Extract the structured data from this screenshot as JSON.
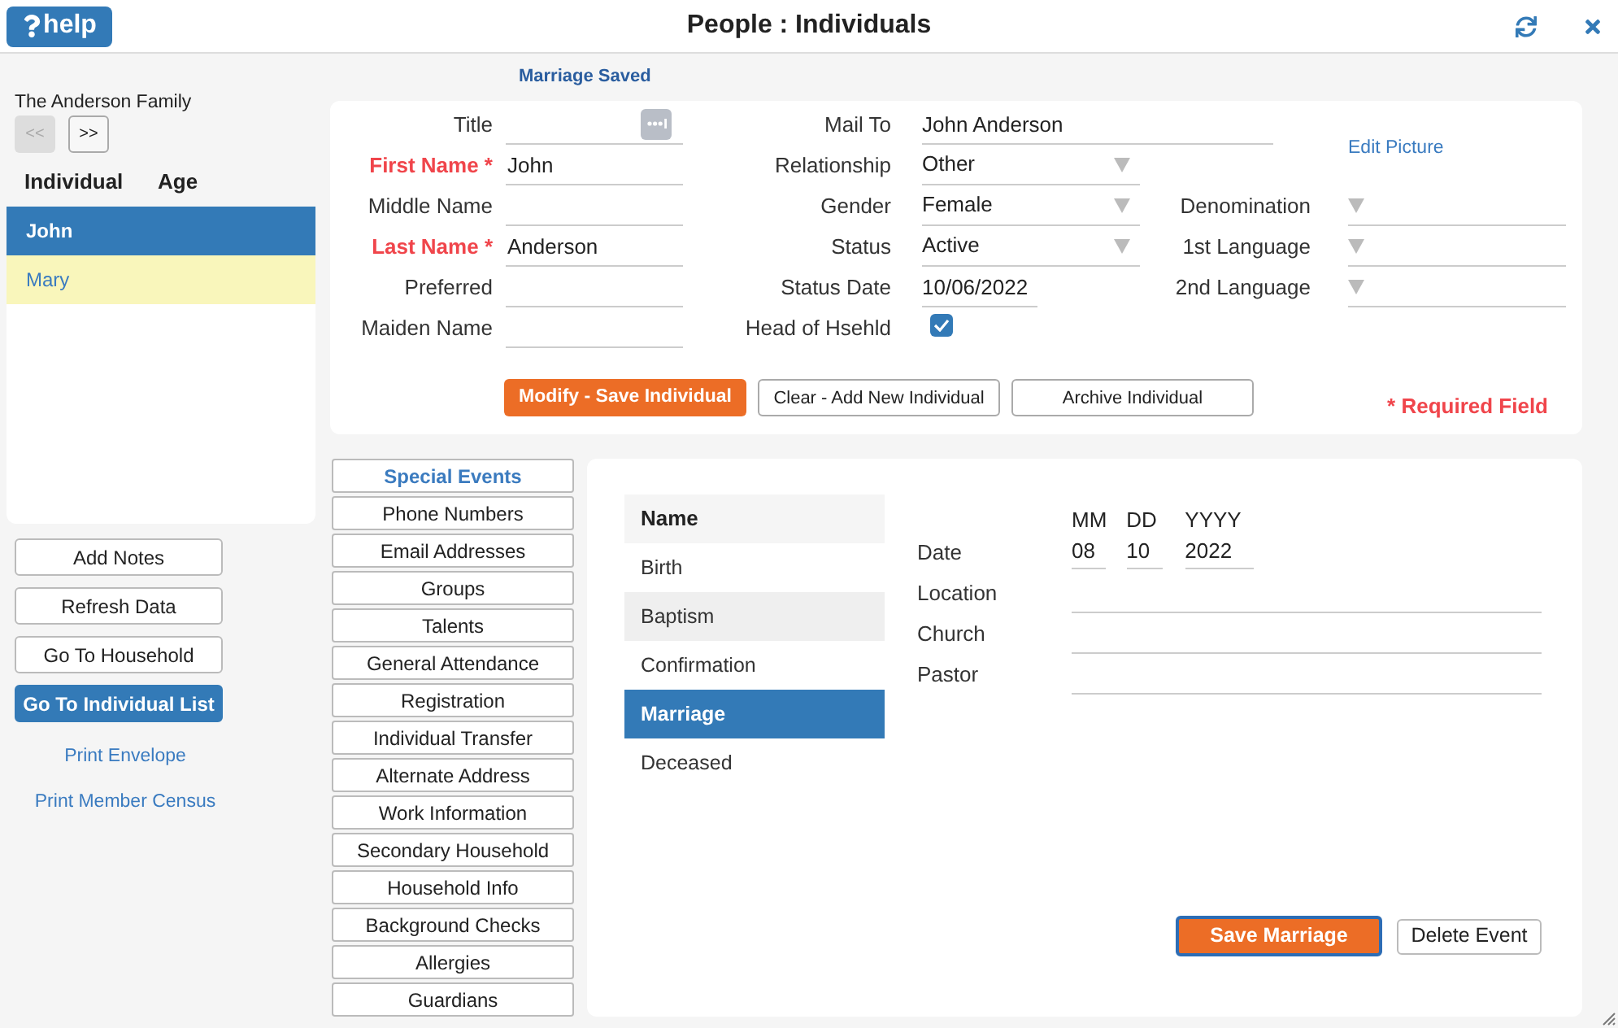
{
  "header": {
    "help": "help",
    "title": "People : Individuals"
  },
  "family": {
    "name": "The Anderson Family",
    "nav": [
      {
        "label": "<<",
        "disabled": true
      },
      {
        "label": ">>",
        "disabled": false
      }
    ]
  },
  "members": {
    "columns": [
      "Individual",
      "Age"
    ],
    "rows": [
      {
        "name": "John",
        "selected": true
      },
      {
        "name": "Mary",
        "selected": false
      }
    ]
  },
  "side_actions": [
    {
      "kind": "button",
      "label": "Add Notes",
      "primary": false
    },
    {
      "kind": "button",
      "label": "Refresh Data",
      "primary": false
    },
    {
      "kind": "button",
      "label": "Go To Household",
      "primary": false
    },
    {
      "kind": "button",
      "label": "Go To Individual List",
      "primary": true
    },
    {
      "kind": "link",
      "label": "Print Envelope"
    },
    {
      "kind": "link",
      "label": "Print Member Census"
    }
  ],
  "status_message": "Marriage Saved",
  "form": {
    "left": [
      {
        "label": "Title",
        "required": false,
        "kind": "lookup"
      },
      {
        "label": "First Name *",
        "required": true,
        "kind": "text",
        "value": "John"
      },
      {
        "label": "Middle Name",
        "required": false,
        "kind": "text"
      },
      {
        "label": "Last Name *",
        "required": true,
        "kind": "text",
        "value": "Anderson"
      },
      {
        "label": "Preferred",
        "required": false,
        "kind": "text"
      },
      {
        "label": "Maiden Name",
        "required": false,
        "kind": "text"
      }
    ],
    "middle": [
      {
        "label": "Mail To",
        "kind": "wide_text",
        "value": "John Anderson"
      },
      {
        "label": "Relationship",
        "kind": "select",
        "value": "Other"
      },
      {
        "label": "Gender",
        "kind": "select",
        "value": "Female"
      },
      {
        "label": "Status",
        "kind": "select",
        "value": "Active"
      },
      {
        "label": "Status Date",
        "kind": "date",
        "value": "10/06/2022"
      },
      {
        "label": "Head of Hsehld",
        "kind": "checkbox",
        "checked": true
      }
    ],
    "edit_picture": "Edit Picture",
    "right": [
      {
        "label": "Denomination",
        "kind": "select"
      },
      {
        "label": "1st Language",
        "kind": "select"
      },
      {
        "label": "2nd Language",
        "kind": "select"
      }
    ],
    "buttons": [
      {
        "label": "Modify - Save Individual",
        "kind": "primary"
      },
      {
        "label": "Clear - Add New Individual",
        "kind": "default"
      },
      {
        "label": "Archive Individual",
        "kind": "default"
      }
    ],
    "required_note": "* Required Field"
  },
  "tabs": [
    {
      "label": "Special Events",
      "selected": true
    },
    {
      "label": "Phone Numbers",
      "selected": false
    },
    {
      "label": "Email Addresses",
      "selected": false
    },
    {
      "label": "Groups",
      "selected": false
    },
    {
      "label": "Talents",
      "selected": false
    },
    {
      "label": "General Attendance",
      "selected": false
    },
    {
      "label": "Registration",
      "selected": false
    },
    {
      "label": "Individual Transfer",
      "selected": false
    },
    {
      "label": "Alternate Address",
      "selected": false
    },
    {
      "label": "Work Information",
      "selected": false
    },
    {
      "label": "Secondary Household",
      "selected": false
    },
    {
      "label": "Household Info",
      "selected": false
    },
    {
      "label": "Background Checks",
      "selected": false
    },
    {
      "label": "Allergies",
      "selected": false
    },
    {
      "label": "Guardians",
      "selected": false
    }
  ],
  "events": {
    "header": "Name",
    "items": [
      {
        "label": "Birth",
        "selected": false
      },
      {
        "label": "Baptism",
        "selected": false
      },
      {
        "label": "Confirmation",
        "selected": false
      },
      {
        "label": "Marriage",
        "selected": true
      },
      {
        "label": "Deceased",
        "selected": false
      }
    ]
  },
  "event_detail": {
    "date": {
      "label": "Date",
      "parts": [
        {
          "label": "MM",
          "value": "08"
        },
        {
          "label": "DD",
          "value": "10"
        },
        {
          "label": "YYYY",
          "value": "2022"
        }
      ]
    },
    "fields": [
      {
        "label": "Location"
      },
      {
        "label": "Church"
      },
      {
        "label": "Pastor"
      }
    ],
    "buttons": [
      {
        "label": "Save Marriage",
        "kind": "primary",
        "focused": true
      },
      {
        "label": "Delete Event",
        "kind": "default",
        "focused": false
      }
    ]
  }
}
